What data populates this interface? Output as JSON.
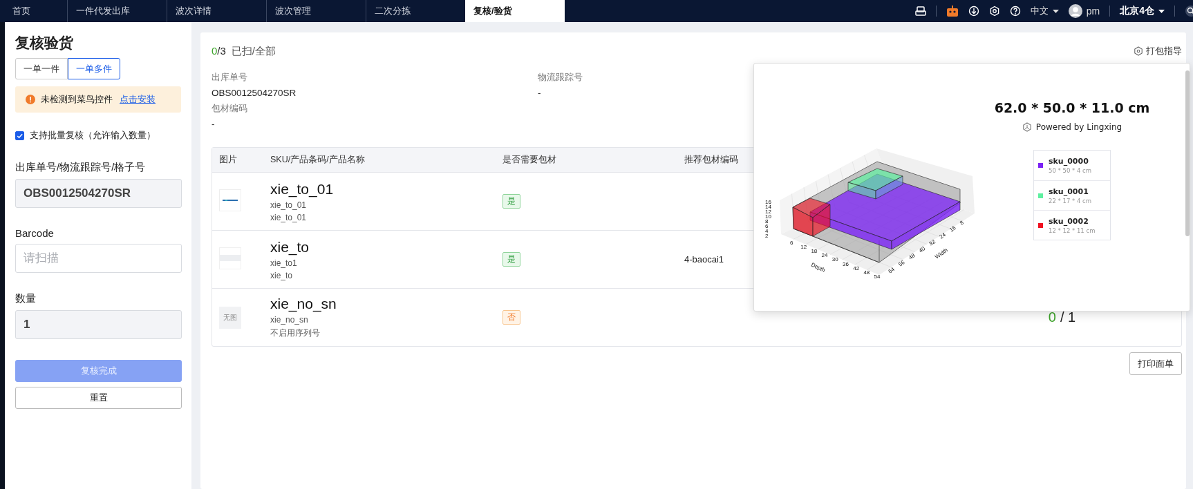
{
  "top_nav": {
    "tabs": [
      {
        "label": "首页",
        "selected": false
      },
      {
        "label": "一件代发出库",
        "selected": false
      },
      {
        "label": "波次详情",
        "selected": false
      },
      {
        "label": "波次管理",
        "selected": false
      },
      {
        "label": "二次分拣",
        "selected": false
      },
      {
        "label": "复核/验货",
        "selected": true
      }
    ],
    "language": "中文",
    "user": "pm",
    "warehouse": "北京4仓"
  },
  "side_panel": {
    "title": "复核验货",
    "modes": [
      {
        "label": "一单一件",
        "selected": false
      },
      {
        "label": "一单多件",
        "selected": true
      }
    ],
    "alert": {
      "message": "未检测到菜鸟控件",
      "link": "点击安装"
    },
    "batch_check": {
      "label": "支持批量复核（允许输入数量）",
      "checked": true
    },
    "fields": [
      {
        "label": "出库单号/物流跟踪号/格子号",
        "value": "OBS0012504270SR",
        "disabled": true
      },
      {
        "label": "Barcode",
        "placeholder": "请扫描",
        "disabled": false
      },
      {
        "label": "数量",
        "value": "1",
        "disabled": true
      }
    ],
    "buttons": [
      {
        "label": "复核完成",
        "kind": "primary",
        "disabled": true
      },
      {
        "label": "重置",
        "kind": "default",
        "disabled": false
      }
    ]
  },
  "main": {
    "progress": {
      "scanned": "0",
      "of_total": "/3",
      "label": "已扫/全部"
    },
    "guide_button": "打包指导",
    "info": [
      {
        "label": "出库单号",
        "value": "OBS0012504270SR"
      },
      {
        "label": "物流跟踪号",
        "value": "-"
      },
      {
        "label": "包材编码",
        "value": "-"
      }
    ],
    "table": {
      "columns": [
        "图片",
        "SKU/产品条码/产品名称",
        "是否需要包材",
        "推荐包材编码"
      ],
      "rows": [
        {
          "image": {
            "kind": "logo"
          },
          "sku": "xie_to_01",
          "barcode": "xie_to_01",
          "name": "xie_to_01",
          "needs_packaging": {
            "label": "是",
            "kind": "yes"
          }
        },
        {
          "image": {
            "kind": "blank"
          },
          "sku": "xie_to",
          "barcode": "xie_to1",
          "name": "xie_to",
          "needs_packaging": {
            "label": "是",
            "kind": "yes"
          },
          "recommended": "4-baocai1"
        },
        {
          "image": {
            "kind": "none",
            "text": "无图"
          },
          "sku": "xie_no_sn",
          "barcode": "xie_no_sn",
          "name": "不启用序列号",
          "needs_packaging": {
            "label": "否",
            "kind": "no"
          },
          "count": {
            "scanned": "0",
            "of_total": "/ 1"
          }
        }
      ]
    },
    "print_button": "打印面单"
  },
  "packing_popup": {
    "dimensions": "62.0 * 50.0 * 11.0 cm",
    "powered_by": "Powered by Lingxing",
    "axes": {
      "depth_label": "Depth",
      "width_label": "Width",
      "z_ticks": [
        "16",
        "14",
        "12",
        "10",
        "8",
        "6",
        "4",
        "2"
      ],
      "depth_ticks": [
        "6",
        "12",
        "18",
        "24",
        "30",
        "36",
        "42",
        "48",
        "54"
      ],
      "width_ticks": [
        "8",
        "16",
        "24",
        "32",
        "40",
        "48",
        "56",
        "64"
      ]
    },
    "items": [
      {
        "name": "sku_0000",
        "size": "50 * 50 * 4 cm",
        "color": "#7b22f5"
      },
      {
        "name": "sku_0001",
        "size": "22 * 17 * 4 cm",
        "color": "#5ef0a0"
      },
      {
        "name": "sku_0002",
        "size": "12 * 12 * 11 cm",
        "color": "#f01020"
      }
    ]
  }
}
